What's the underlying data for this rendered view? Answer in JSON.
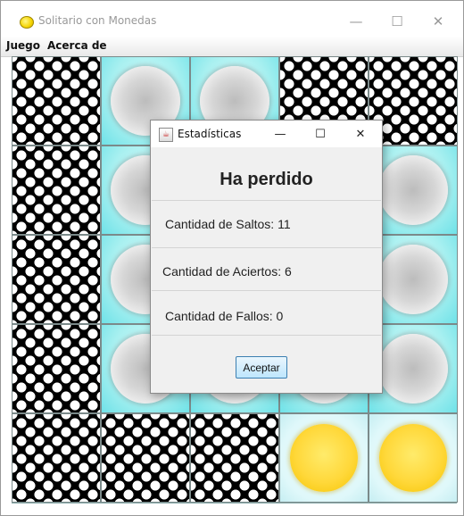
{
  "window": {
    "title": "Solitario con Monedas",
    "minimize_icon": "minimize-icon",
    "maximize_icon": "maximize-icon",
    "close_icon": "close-icon"
  },
  "menubar": {
    "items": [
      {
        "label": "Juego"
      },
      {
        "label": "Acerca de"
      }
    ]
  },
  "board": {
    "rows": 5,
    "cols": 5,
    "cells": [
      [
        "dots",
        "cyan-ball",
        "cyan-ball",
        "dots",
        "dots"
      ],
      [
        "dots",
        "cyan-ball",
        "cyan-ball",
        "cyan-ball",
        "cyan-ball"
      ],
      [
        "dots",
        "cyan-ball",
        "cyan-ball",
        "cyan-ball",
        "cyan-ball"
      ],
      [
        "dots",
        "cyan-ball",
        "cyan-ball",
        "cyan-ball",
        "cyan-ball"
      ],
      [
        "dots",
        "dots",
        "dots",
        "coin",
        "coin"
      ]
    ],
    "colors": {
      "coin": "#ffd83a",
      "cyan": "#a8f0f0"
    }
  },
  "dialog": {
    "title": "Estadísticas",
    "heading": "Ha perdido",
    "stats": [
      {
        "label": "Cantidad de Saltos: 11"
      },
      {
        "label": "Cantidad de Aciertos: 6"
      },
      {
        "label": "Cantidad de Fallos: 0"
      }
    ],
    "ok_label": "Aceptar"
  }
}
